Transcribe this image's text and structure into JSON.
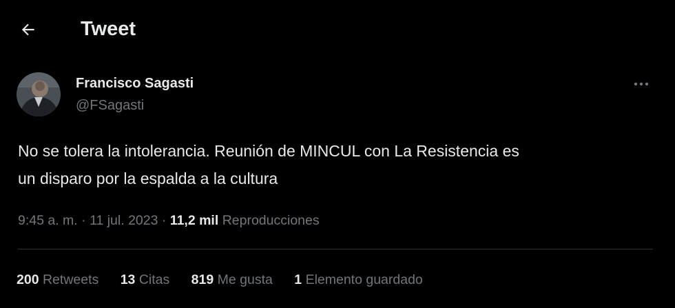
{
  "header": {
    "back_icon": "arrow-left-icon",
    "title": "Tweet"
  },
  "author": {
    "name": "Francisco Sagasti",
    "handle": "@FSagasti",
    "more_icon": "more-horizontal-icon"
  },
  "tweet": {
    "text_line1": "No se tolera la intolerancia. Reunión de MINCUL con La Resistencia es",
    "text_line2": "un disparo por la espalda a la cultura"
  },
  "meta": {
    "time": "9:45 a. m.",
    "sep1": " · ",
    "date": "11 jul. 2023",
    "sep2": " · ",
    "views_count": "11,2 mil",
    "views_label": "Reproducciones"
  },
  "stats": {
    "retweets_count": "200",
    "retweets_label": "Retweets",
    "quotes_count": "13",
    "quotes_label": "Citas",
    "likes_count": "819",
    "likes_label": "Me gusta",
    "bookmarks_count": "1",
    "bookmarks_label": "Elemento guardado"
  },
  "colors": {
    "background": "#000000",
    "primary_text": "#e7e9ea",
    "secondary_text": "#71767b",
    "divider": "#2f3336"
  }
}
